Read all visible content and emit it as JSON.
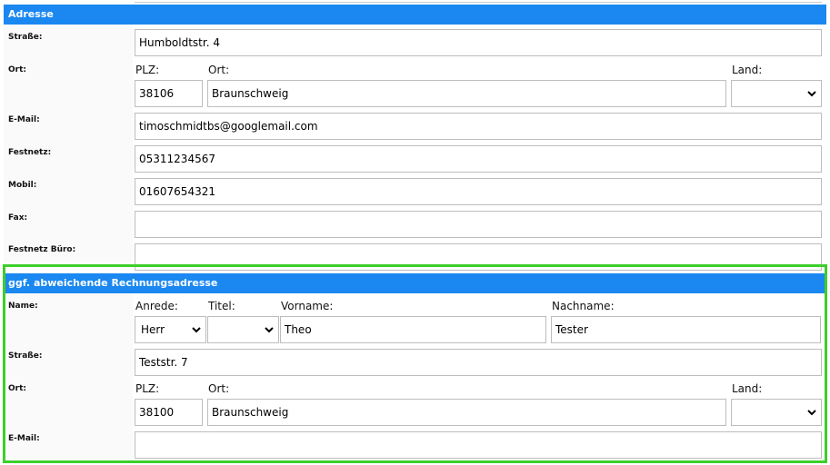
{
  "address": {
    "header": "Adresse",
    "labels": {
      "street": "Straße:",
      "city": "Ort:",
      "email": "E-Mail:",
      "landline": "Festnetz:",
      "mobile": "Mobil:",
      "fax": "Fax:",
      "office_landline": "Festnetz Büro:"
    },
    "field_labels": {
      "plz": "PLZ:",
      "ort": "Ort:",
      "land": "Land:"
    },
    "values": {
      "street": "Humboldtstr. 4",
      "plz": "38106",
      "ort": "Braunschweig",
      "land": "",
      "email": "timoschmidtbs@googlemail.com",
      "landline": "05311234567",
      "mobile": "01607654321",
      "fax": "",
      "office_landline": ""
    }
  },
  "billing": {
    "header": "ggf. abweichende Rechnungsadresse",
    "labels": {
      "name": "Name:",
      "street": "Straße:",
      "city": "Ort:",
      "email": "E-Mail:"
    },
    "field_labels": {
      "anrede": "Anrede:",
      "titel": "Titel:",
      "vorname": "Vorname:",
      "nachname": "Nachname:",
      "plz": "PLZ:",
      "ort": "Ort:",
      "land": "Land:"
    },
    "values": {
      "anrede": "Herr",
      "titel": "",
      "vorname": "Theo",
      "nachname": "Tester",
      "street": "Teststr. 7",
      "plz": "38100",
      "ort": "Braunschweig",
      "land": "",
      "email": ""
    }
  },
  "colors": {
    "header_bg": "#1a88f0",
    "highlight": "#3ecf2a",
    "border": "#bdbdbd"
  },
  "icons": {
    "select_arrow": "chevron-down-icon"
  }
}
